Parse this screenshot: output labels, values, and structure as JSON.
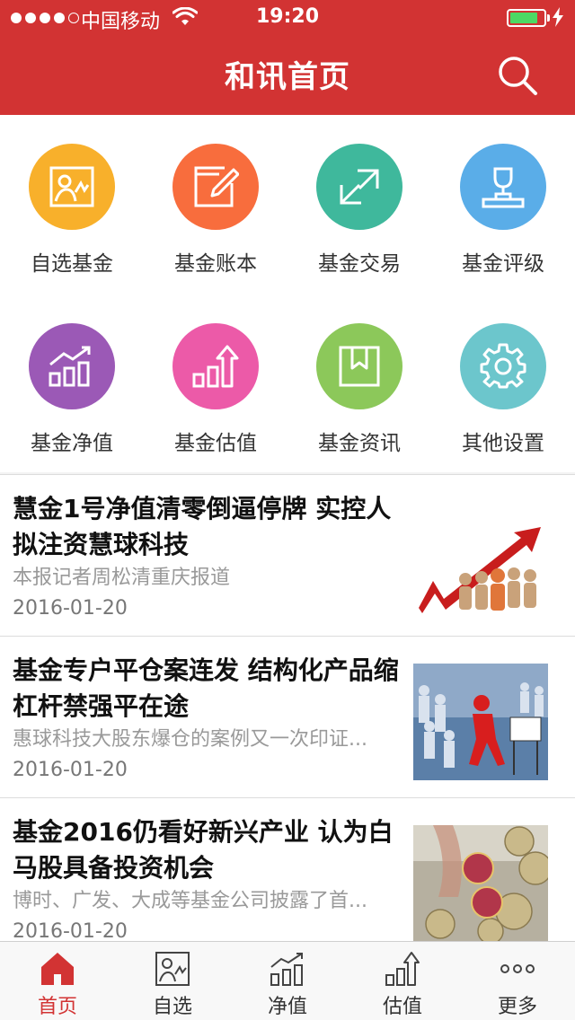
{
  "status_bar": {
    "carrier": "中国移动",
    "time": "19:20"
  },
  "header": {
    "title": "和讯首页",
    "search_icon": "search-icon"
  },
  "grid": [
    {
      "label": "自选基金",
      "icon": "image-frame-icon",
      "color": "#f8b02b"
    },
    {
      "label": "基金账本",
      "icon": "edit-note-icon",
      "color": "#f86d3d"
    },
    {
      "label": "基金交易",
      "icon": "exchange-arrows-icon",
      "color": "#3fb89c"
    },
    {
      "label": "基金评级",
      "icon": "trophy-icon",
      "color": "#5aade8"
    },
    {
      "label": "基金净值",
      "icon": "bar-chart-up-icon",
      "color": "#9b59b6"
    },
    {
      "label": "基金估值",
      "icon": "bar-chart-arrow-icon",
      "color": "#ec5aa8"
    },
    {
      "label": "基金资讯",
      "icon": "bookmark-book-icon",
      "color": "#8cc85a"
    },
    {
      "label": "其他设置",
      "icon": "gear-icon",
      "color": "#6cc6cc"
    }
  ],
  "news": [
    {
      "title": "慧金1号净值清零倒逼停牌 实控人拟注资慧球科技",
      "summary": "本报记者周松清重庆报道",
      "date": "2016-01-20",
      "thumb": "people-red-arrow-image"
    },
    {
      "title": "基金专户平仓案连发 结构化产品缩杠杆禁强平在途",
      "summary": "惠球科技大股东爆仓的案例又一次印证...",
      "date": "2016-01-20",
      "thumb": "figures-sign-image"
    },
    {
      "title": "基金2016仍看好新兴产业 认为白马股具备投资机会",
      "summary": "博时、广发、大成等基金公司披露了首...",
      "date": "2016-01-20",
      "thumb": "coins-fund-image"
    }
  ],
  "tabs": [
    {
      "label": "首页",
      "icon": "home-icon",
      "active": true
    },
    {
      "label": "自选",
      "icon": "image-frame-icon",
      "active": false
    },
    {
      "label": "净值",
      "icon": "bar-chart-up-icon",
      "active": false
    },
    {
      "label": "估值",
      "icon": "bar-chart-arrow-icon",
      "active": false
    },
    {
      "label": "更多",
      "icon": "more-dots-icon",
      "active": false
    }
  ],
  "colors": {
    "brand_red": "#d23333",
    "battery_green": "#4cd964"
  }
}
